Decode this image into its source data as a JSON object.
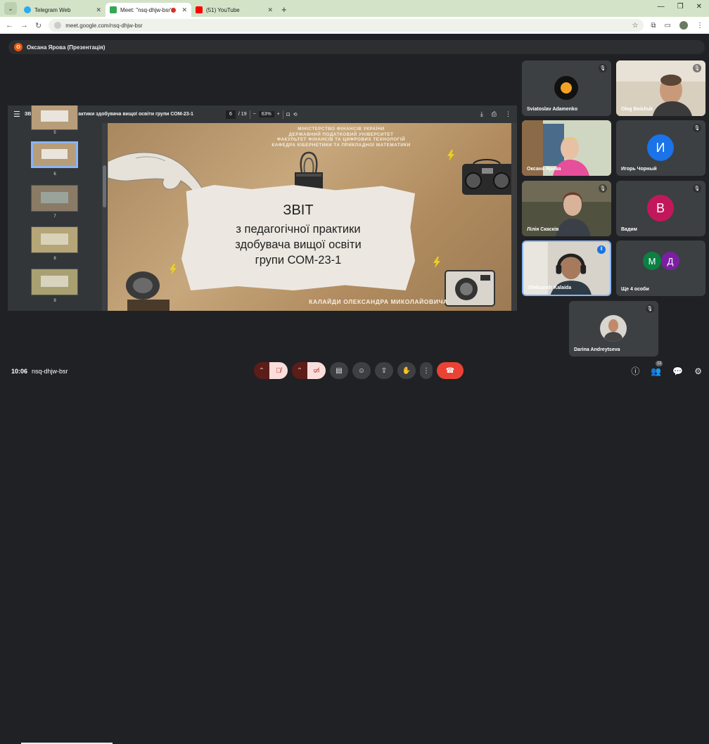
{
  "browser": {
    "tabs": [
      {
        "title": "Telegram Web",
        "fav_color": "#2aabee"
      },
      {
        "title": "Meet: \"nsq-dhjw-bsr\"",
        "fav_color": "#34a853"
      },
      {
        "title": "(51) YouTube",
        "fav_color": "#ff0000"
      }
    ],
    "url": "meet.google.com/nsq-dhjw-bsr"
  },
  "presenter": {
    "initial": "О",
    "label": "Оксана Ярова (Презентація)"
  },
  "viewer": {
    "doc_title": "ЗВІТ з педагогічної практики здобувача вищої освіти групи СОМ-23-1",
    "page_current": "6",
    "page_total": "/ 19",
    "zoom": "63%",
    "thumb_numbers": [
      "5",
      "6",
      "7",
      "8",
      "9"
    ]
  },
  "slide": {
    "ministry_lines": [
      "МІНІСТЕРСТВО ФІНАНСІВ УКРАЇНИ",
      "ДЕРЖАВНИЙ ПОДАТКОВИЙ УНІВЕРСИТЕТ",
      "ФАКУЛЬТЕТ ФІНАНСІВ ТА ЦИФРОВИХ ТЕХНОЛОГІЙ",
      "КАФЕДРА КІБЕРНЕТИКИ ТА ПРИКЛАДНОЇ МАТЕМАТИКИ"
    ],
    "title": "ЗВІТ",
    "subtitle_lines": [
      "з педагогічної практики",
      "здобувача вищої освіти",
      "групи СОМ-23-1"
    ],
    "author": "КАЛАЙДИ ОЛЕКСАНДРА МИКОЛАЙОВИЧА"
  },
  "participants": [
    {
      "name": "Sviatoslav Adamenko"
    },
    {
      "name": "Oleg Boichuk"
    },
    {
      "name": "Оксана Ярова"
    },
    {
      "name": "Игорь Чорный",
      "initial": "И",
      "color": "#1a73e8"
    },
    {
      "name": "Лілія Скасків"
    },
    {
      "name": "Вадим",
      "initial": "В",
      "color": "#c2185b"
    },
    {
      "name": "Oleksandr Kalaida"
    },
    {
      "name": "Ще 4 особи",
      "initials": [
        "М",
        "Д"
      ],
      "colors": [
        "#0b8043",
        "#7b1fa2"
      ]
    },
    {
      "name": "Darina Andreytseva"
    }
  ],
  "meeting": {
    "time": "10:06",
    "code": "nsq-dhjw-bsr",
    "people_count": "13"
  }
}
